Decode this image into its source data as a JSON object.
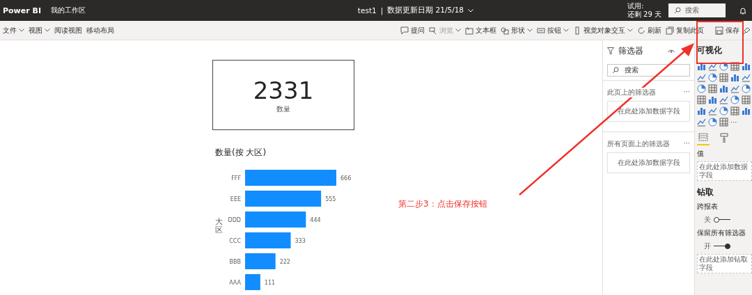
{
  "top_bar": {
    "app": "Power BI",
    "workspace": "我的工作区",
    "report": "test1",
    "separator": "|",
    "updated": "数据更新日期 21/5/18",
    "trial_line1": "试用:",
    "trial_line2": "还剩 29 天",
    "search": {
      "placeholder": "搜索"
    }
  },
  "toolbar": {
    "left": [
      {
        "label": "文件",
        "dropdown": true
      },
      {
        "label": "视图",
        "dropdown": true
      },
      {
        "label": "阅读视图",
        "dropdown": false
      },
      {
        "label": "移动布局",
        "dropdown": false
      }
    ],
    "right": [
      {
        "label": "提问",
        "dropdown": false,
        "disabled": false
      },
      {
        "label": "浏览",
        "dropdown": true,
        "disabled": true
      },
      {
        "label": "文本框",
        "dropdown": false,
        "disabled": false
      },
      {
        "label": "形状",
        "dropdown": true,
        "disabled": false
      },
      {
        "label": "按钮",
        "dropdown": true,
        "disabled": false
      },
      {
        "label": "视觉对象交互",
        "dropdown": true,
        "disabled": false
      },
      {
        "label": "刷新",
        "dropdown": false,
        "disabled": false
      },
      {
        "label": "复制此页",
        "dropdown": false,
        "disabled": false
      },
      {
        "label": "保存",
        "dropdown": false,
        "disabled": false
      }
    ]
  },
  "card": {
    "value": "2331",
    "label": "数量"
  },
  "chart": {
    "chart_data": {
      "type": "bar",
      "orientation": "horizontal",
      "title": "数量(按 大区)",
      "ylabel": "大区",
      "categories": [
        "FFF",
        "EEE",
        "DDD",
        "CCC",
        "BBB",
        "AAA"
      ],
      "values": [
        666,
        555,
        444,
        333,
        222,
        111
      ],
      "data_labels": true
    }
  },
  "annotation": {
    "text": "第二步3：点击保存按钮"
  },
  "filters": {
    "title": "筛选器",
    "search": {
      "placeholder": "搜索"
    },
    "sections": [
      {
        "title": "此页上的筛选器",
        "more": "···",
        "well": "在此处添加数据字段"
      },
      {
        "title": "所有页面上的筛选器",
        "more": "···",
        "well": "在此处添加数据字段"
      }
    ]
  },
  "visualizations": {
    "title": "可视化",
    "more": "···",
    "values_label": "值",
    "values_well": "在此处添加数据字段",
    "drill_title": "钻取",
    "cross_report": {
      "label": "跨报表",
      "state": "关",
      "on": false
    },
    "keep_filters": {
      "label": "保留所有筛选器",
      "state": "开",
      "on": true
    },
    "drill_well": "在此处添加钻取字段"
  }
}
